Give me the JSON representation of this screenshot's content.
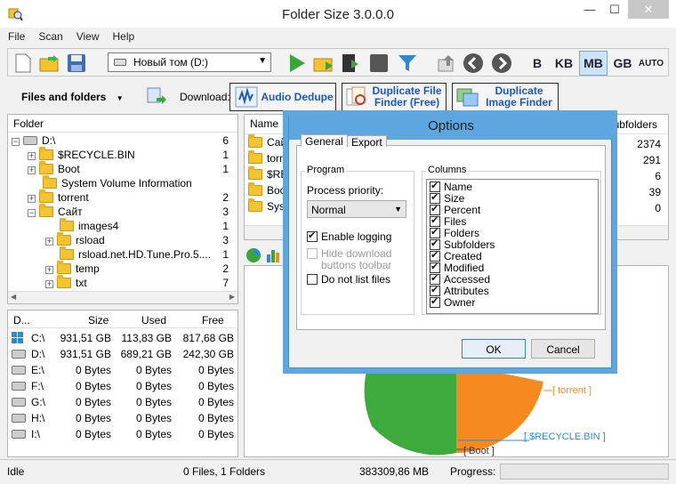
{
  "window": {
    "title": "Folder Size 3.0.0.0"
  },
  "menu": [
    "File",
    "Scan",
    "View",
    "Help"
  ],
  "toolbar": {
    "drive_combo_value": "Новый том (D:)",
    "units": [
      "B",
      "KB",
      "MB",
      "GB",
      "AUTO"
    ],
    "selected_unit": "MB"
  },
  "row2": {
    "files_and_folders_label": "Files and folders",
    "download_label": "Download:",
    "audio_dedupe": "Audio Dedupe",
    "duplicate_file_finder": "Duplicate File Finder (Free)",
    "duplicate_image_finder": "Duplicate Image Finder"
  },
  "tree": {
    "header": "Folder",
    "items": [
      {
        "label": "D:\\",
        "count": "6"
      },
      {
        "label": "$RECYCLE.BIN",
        "count": "1"
      },
      {
        "label": "Boot",
        "count": "1"
      },
      {
        "label": "System Volume Information",
        "count": ""
      },
      {
        "label": "torrent",
        "count": "2"
      },
      {
        "label": "Сайт",
        "count": "3"
      },
      {
        "label": "images4",
        "count": "1"
      },
      {
        "label": "rsload",
        "count": "3"
      },
      {
        "label": "rsload.net.HD.Tune.Pro.5....",
        "count": "1"
      },
      {
        "label": "temp",
        "count": "2"
      },
      {
        "label": "txt",
        "count": "7"
      }
    ]
  },
  "drives": {
    "headers": [
      "D...",
      "Size",
      "Used",
      "Free"
    ],
    "rows": [
      {
        "drive": "C:\\",
        "size": "931,51 GB",
        "used": "113,83 GB",
        "free": "817,68 GB"
      },
      {
        "drive": "D:\\",
        "size": "931,51 GB",
        "used": "689,21 GB",
        "free": "242,30 GB"
      },
      {
        "drive": "E:\\",
        "size": "0 Bytes",
        "used": "0 Bytes",
        "free": "0 Bytes"
      },
      {
        "drive": "F:\\",
        "size": "0 Bytes",
        "used": "0 Bytes",
        "free": "0 Bytes"
      },
      {
        "drive": "G:\\",
        "size": "0 Bytes",
        "used": "0 Bytes",
        "free": "0 Bytes"
      },
      {
        "drive": "H:\\",
        "size": "0 Bytes",
        "used": "0 Bytes",
        "free": "0 Bytes"
      },
      {
        "drive": "I:\\",
        "size": "0 Bytes",
        "used": "0 Bytes",
        "free": "0 Bytes"
      }
    ]
  },
  "list": {
    "col_name": "Name",
    "col_subfolders": "Subfolders",
    "rows": [
      {
        "name": "Сайт",
        "subfolders": "2374"
      },
      {
        "name": "torre",
        "subfolders": "291"
      },
      {
        "name": "$REC",
        "subfolders": "6"
      },
      {
        "name": "Boot",
        "subfolders": "39"
      },
      {
        "name": "Syste",
        "subfolders": "0"
      }
    ]
  },
  "chart_labels": {
    "torrent": "[ torrent ]",
    "recycle": "[ $RECYCLE.BIN ]",
    "boot": "[ Boot ]"
  },
  "status": {
    "state": "Idle",
    "files": "0 Files, 1 Folders",
    "size": "383309,86 MB",
    "progress_label": "Progress:"
  },
  "dialog": {
    "title": "Options",
    "tabs": [
      "General",
      "Export"
    ],
    "program_group": "Program",
    "priority_label": "Process priority:",
    "priority_value": "Normal",
    "enable_logging": "Enable logging",
    "hide_download": "Hide download buttons toolbar",
    "do_not_list": "Do not list files",
    "columns_group": "Columns",
    "columns": [
      "Name",
      "Size",
      "Percent",
      "Files",
      "Folders",
      "Subfolders",
      "Created",
      "Modified",
      "Accessed",
      "Attributes",
      "Owner"
    ],
    "ok": "OK",
    "cancel": "Cancel"
  },
  "colors": {
    "accent_blue": "#1a58c8",
    "dialog_frame": "#5ea6e0",
    "pie_green": "#3daa3d",
    "pie_orange": "#f68a1f"
  }
}
